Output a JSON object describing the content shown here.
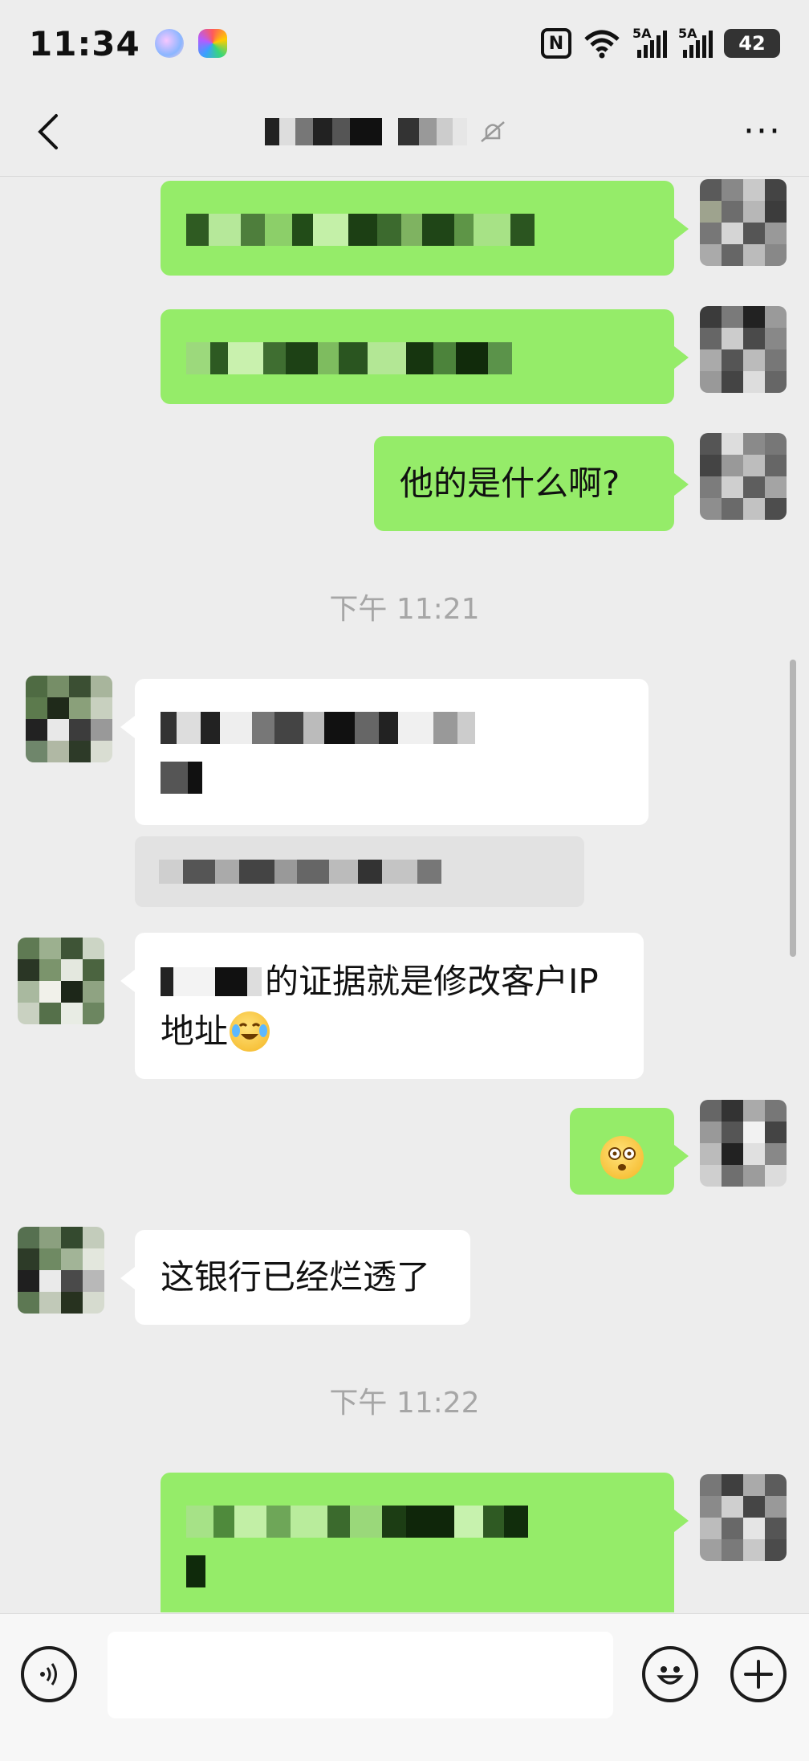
{
  "status_bar": {
    "time": "11:34",
    "nfc_label": "N",
    "network_1": "5A",
    "network_2": "5A",
    "battery": "42",
    "icons": [
      "app-orb-icon",
      "app-star-icon",
      "nfc-icon",
      "wifi-icon",
      "signal-icon",
      "signal-icon",
      "battery-icon"
    ]
  },
  "nav": {
    "back_icon": "chevron-left-icon",
    "more_label": "···",
    "muted_icon": "bell-off-icon"
  },
  "messages": [
    {
      "side": "right",
      "type": "blurred"
    },
    {
      "side": "right",
      "type": "blurred"
    },
    {
      "side": "right",
      "type": "text",
      "text": "他的是什么啊?"
    },
    {
      "type": "time",
      "text": "下午 11:21"
    },
    {
      "side": "left",
      "type": "blurred"
    },
    {
      "side": "left",
      "type": "text",
      "text": "的证据就是修改客户IP",
      "text2": "地址"
    },
    {
      "side": "right",
      "type": "emoji",
      "emoji": "dizzy-face-emoji"
    },
    {
      "side": "left",
      "type": "text",
      "text": "这银行已经烂透了"
    },
    {
      "type": "time",
      "text": "下午 11:22"
    },
    {
      "side": "right",
      "type": "blurred"
    }
  ],
  "input": {
    "value": "",
    "voice_icon": "voice-icon",
    "emoji_icon": "smiley-icon",
    "plus_icon": "plus-icon"
  },
  "colors": {
    "background": "#ededed",
    "bubble_self": "#95ec69",
    "bubble_other": "#ffffff",
    "timestamp": "#a6a6a6"
  }
}
